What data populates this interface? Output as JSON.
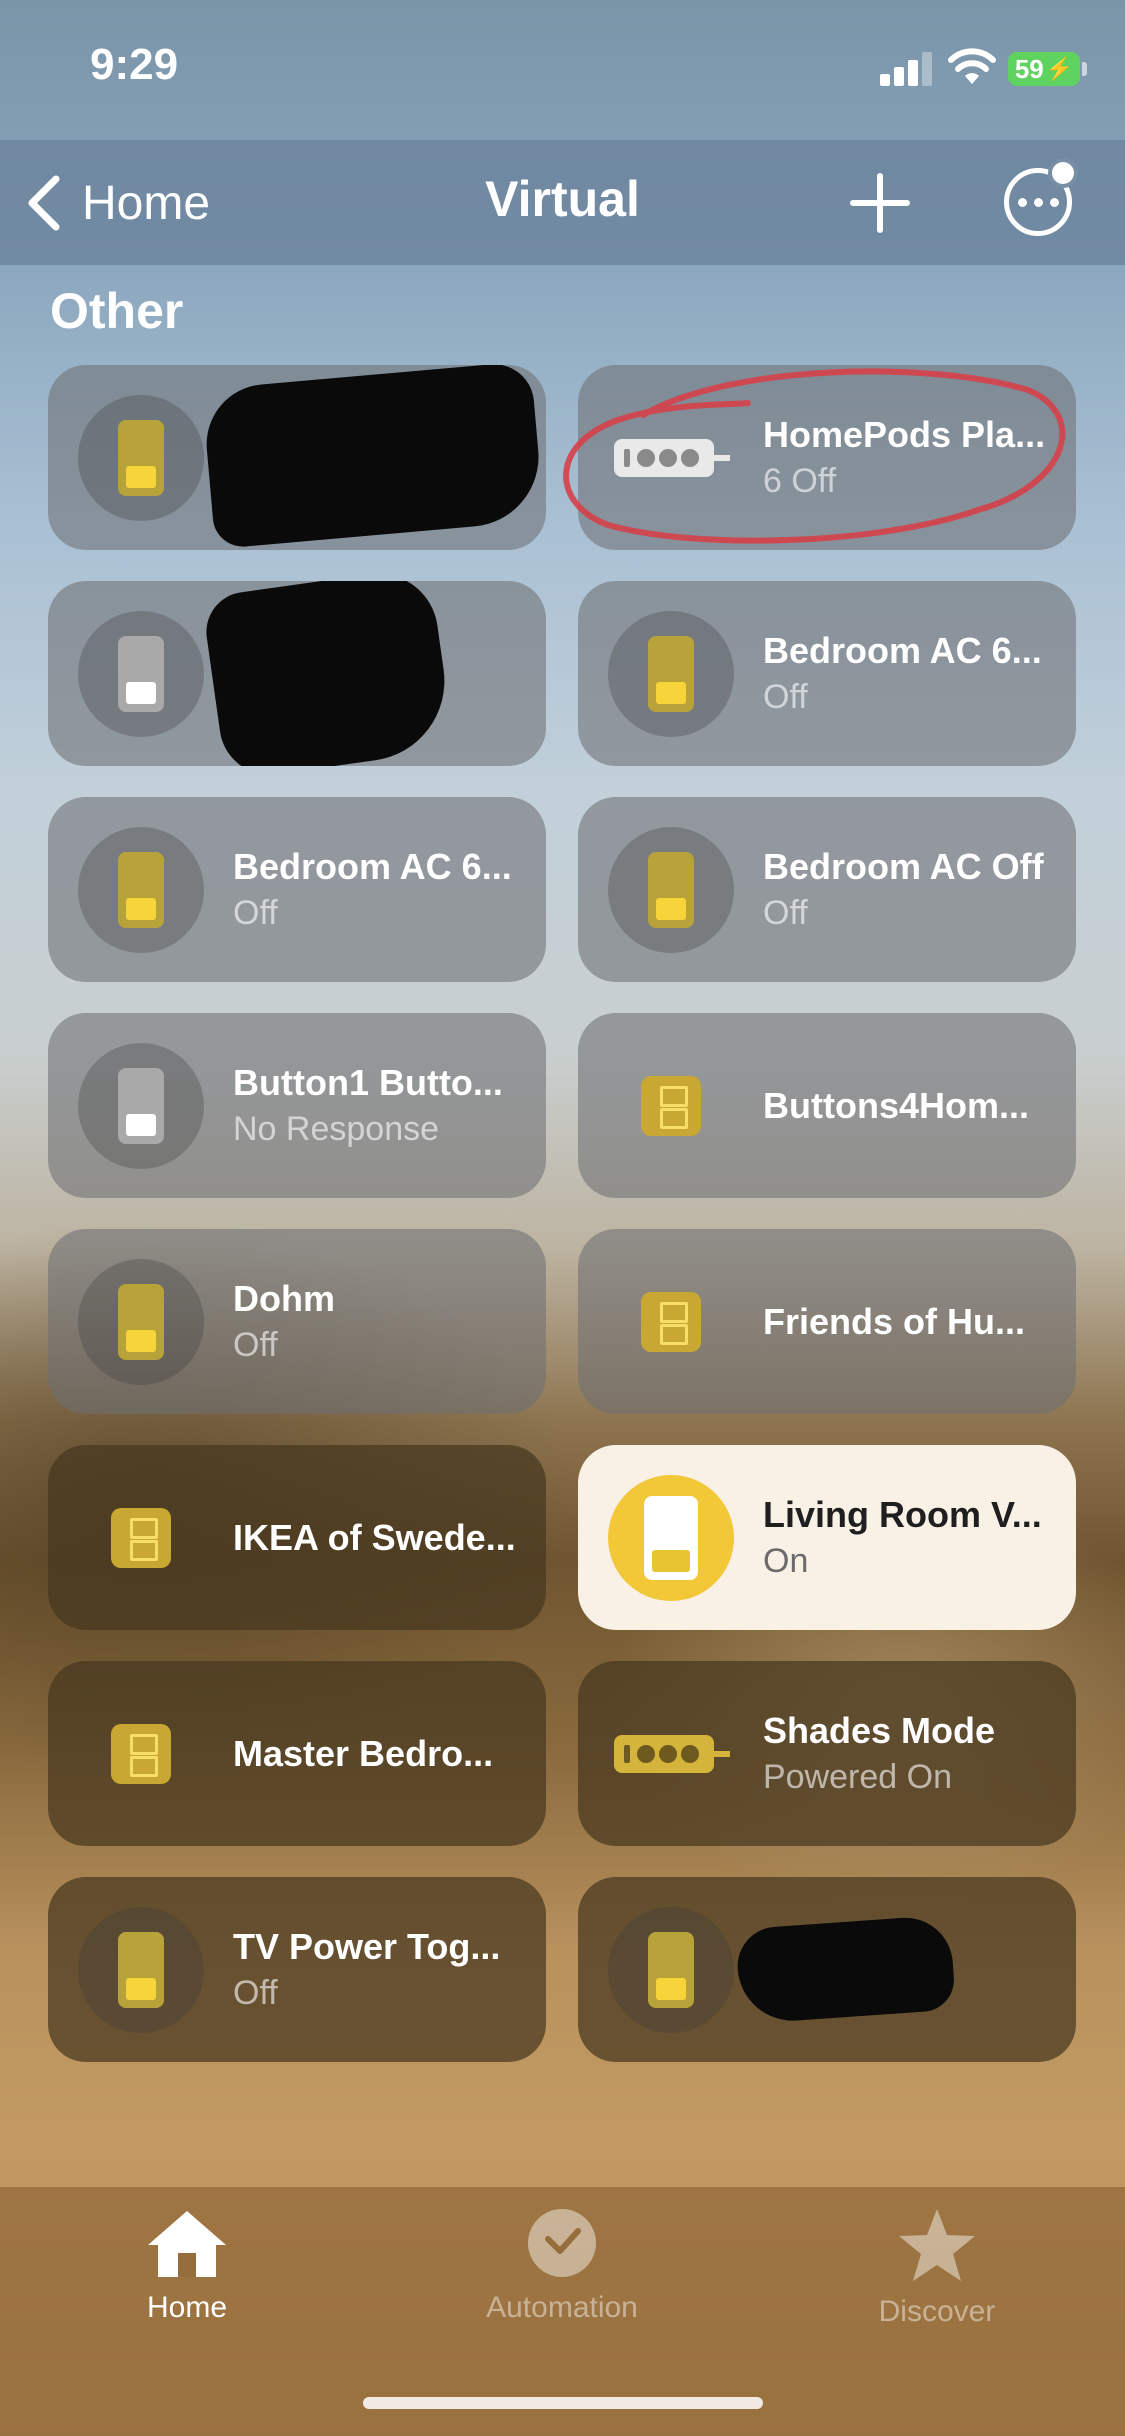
{
  "status_bar": {
    "time": "9:29",
    "battery": "59"
  },
  "nav": {
    "back_label": "Home",
    "title": "Virtual"
  },
  "section": {
    "title": "Other"
  },
  "tiles": [
    {
      "name": "",
      "status": ""
    },
    {
      "name": "HomePods Pla...",
      "status": "6 Off"
    },
    {
      "name": "",
      "status": ""
    },
    {
      "name": "Bedroom AC 6...",
      "status": "Off"
    },
    {
      "name": "Bedroom AC 6...",
      "status": "Off"
    },
    {
      "name": "Bedroom AC Off",
      "status": "Off"
    },
    {
      "name": "Button1 Butto...",
      "status": "No Response"
    },
    {
      "name": "Buttons4Hom...",
      "status": ""
    },
    {
      "name": "Dohm",
      "status": "Off"
    },
    {
      "name": "Friends of Hu...",
      "status": ""
    },
    {
      "name": "IKEA of Swede...",
      "status": ""
    },
    {
      "name": "Living Room V...",
      "status": "On"
    },
    {
      "name": "Master Bedro...",
      "status": ""
    },
    {
      "name": "Shades Mode",
      "status": "Powered On"
    },
    {
      "name": "TV Power Tog...",
      "status": "Off"
    },
    {
      "name": "",
      "status": ""
    }
  ],
  "tab_bar": {
    "tabs": [
      {
        "label": "Home",
        "icon": "house-icon",
        "active": true
      },
      {
        "label": "Automation",
        "icon": "clock-check-icon",
        "active": false
      },
      {
        "label": "Discover",
        "icon": "star-icon",
        "active": false
      }
    ]
  },
  "colors": {
    "accent_yellow": "#f2c838",
    "annotation_red": "#d6404a"
  }
}
